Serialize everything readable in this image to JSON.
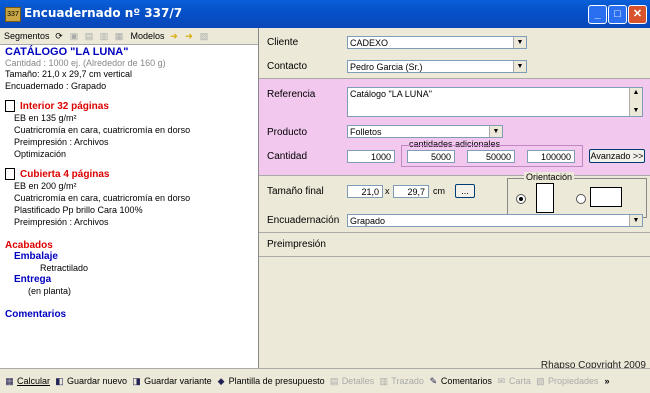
{
  "window": {
    "title": "Encuadernado nº 337/7",
    "app_icon": "app-icon",
    "buttons": [
      "_",
      "□",
      "✕"
    ]
  },
  "left_toolbar": {
    "segmentos": "Segmentos",
    "modelos": "Modelos"
  },
  "summary": {
    "title": "CATÁLOGO \"LA LUNA\"",
    "cantidad": "Cantidad : 1000 ej. (Alrededor de 160 g)",
    "tamano": "Tamaño: 21,0 x 29,7  cm  vertical",
    "encuadernado": "Encuadernado : Grapado",
    "interior": {
      "head": "Interior 32 páginas",
      "lines": [
        "EB en 135 g/m²",
        "Cuatricromía en cara, cuatricromía en dorso",
        "Preimpresión : Archivos",
        "Optimización"
      ]
    },
    "cubierta": {
      "head": "Cubierta 4 páginas",
      "lines": [
        "EB en 200 g/m²",
        "Cuatricromía en cara, cuatricromía en dorso",
        "Plastificado Pp brillo Cara 100%",
        "Preimpresión : Archivos"
      ]
    },
    "acabados": "Acabados",
    "embalaje": "Embalaje",
    "retractilado": "Retractilado",
    "entrega": "Entrega",
    "en_planta": "(en planta)",
    "comentarios": "Comentarios"
  },
  "form": {
    "cliente_label": "Cliente",
    "cliente_value": "CADEXO",
    "contacto_label": "Contacto",
    "contacto_value": "Pedro Garcia (Sr.)",
    "referencia_label": "Referencia",
    "referencia_value": "Catálogo \"LA LUNA\"",
    "producto_label": "Producto",
    "producto_value": "Folletos",
    "cantidades_adicionales": "cantidades adicionales",
    "cantidad_label": "Cantidad",
    "cantidad_value": "1000",
    "cantidades": [
      "5000",
      "50000",
      "100000"
    ],
    "avanzado": "Avanzado >>",
    "tamano_label": "Tamaño final",
    "ancho": "21,0",
    "x": "x",
    "alto": "29,7",
    "unidad": "cm",
    "browse": "...",
    "orientacion": "Orientación",
    "encuadernacion_label": "Encuadernación",
    "encuadernacion_value": "Grapado",
    "preimpresion_label": "Preimpresión",
    "copyright": "Rhapso Copyright 2009"
  },
  "statusbar": {
    "calcular": "Calcular",
    "guardar_nuevo": "Guardar nuevo",
    "guardar_variante": "Guardar variante",
    "plantilla": "Plantilla de presupuesto",
    "detalles": "Detalles",
    "trazado": "Trazado",
    "comentarios": "Comentarios",
    "carta": "Carta",
    "propiedades": "Propiedades",
    "more": "»"
  },
  "colors": {
    "titlebar": "#0550c8",
    "pink_panel": "#f2c8ee",
    "title_blue": "#0000c0",
    "section_red": "#dd0000"
  }
}
